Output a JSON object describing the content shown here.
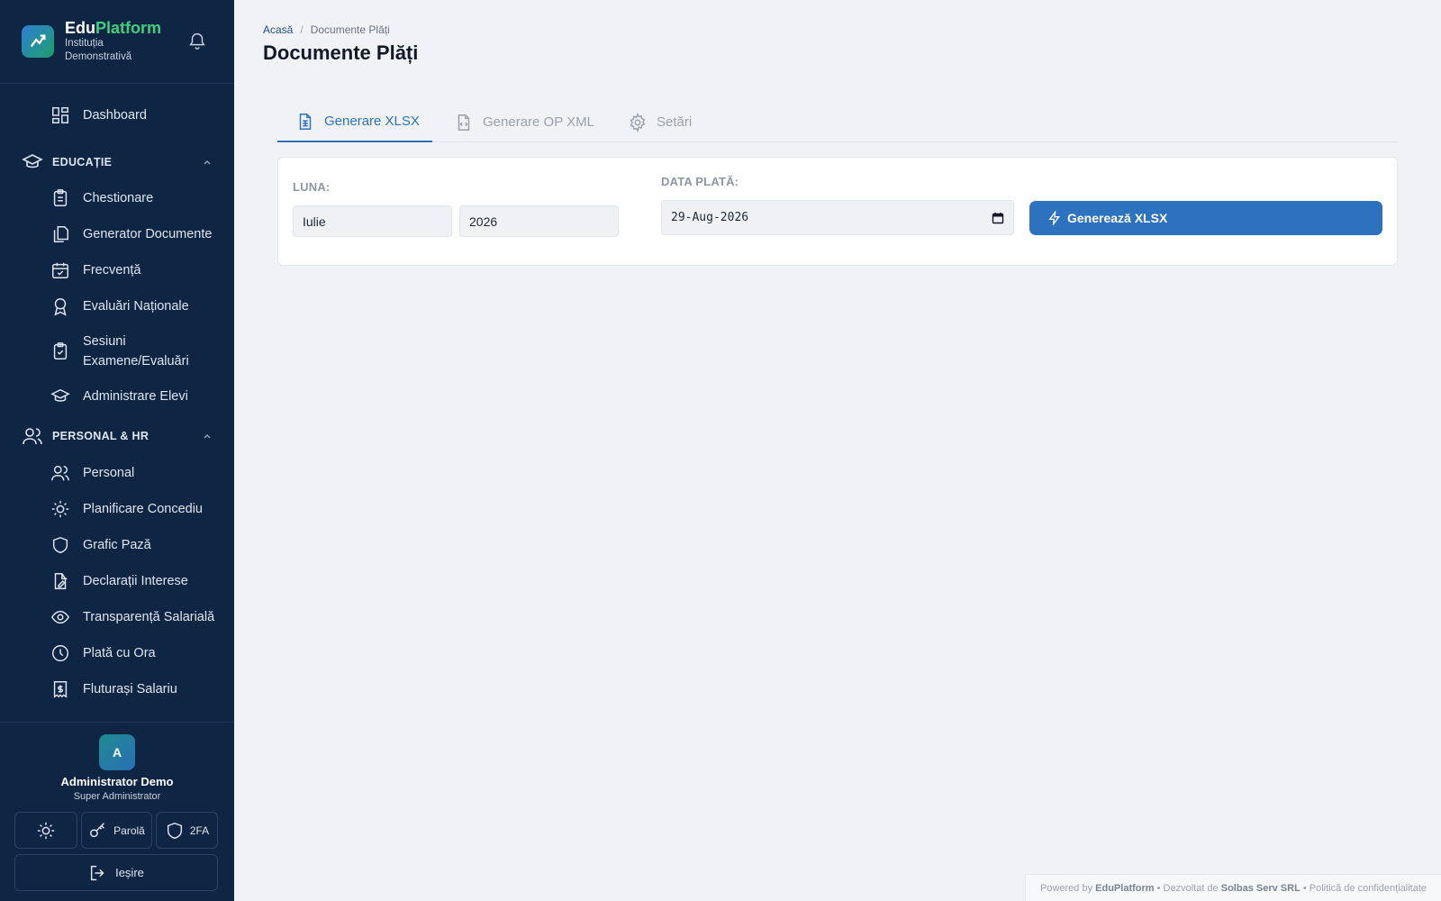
{
  "brand": {
    "name_part1": "Edu",
    "name_part2": "Platform",
    "institution": "Instituția Demonstrativă"
  },
  "sidebar": {
    "dashboard": "Dashboard",
    "sections": {
      "education": "EDUCAȚIE",
      "hr": "PERSONAL & HR"
    },
    "education_items": [
      "Chestionare",
      "Generator Documente",
      "Frecvență",
      "Evaluări Naționale",
      "Sesiuni Examene/Evaluări",
      "Administrare Elevi"
    ],
    "hr_items": [
      "Personal",
      "Planificare Concediu",
      "Grafic Pază",
      "Declarații Interese",
      "Transparență Salarială",
      "Plată cu Ora",
      "Fluturași Salariu"
    ]
  },
  "user": {
    "initial": "A",
    "name": "Administrator Demo",
    "role": "Super Administrator",
    "password_label": "Parolă",
    "twofa_label": "2FA",
    "logout_label": "Ieșire"
  },
  "breadcrumb": {
    "home": "Acasă",
    "separator": "/",
    "current": "Documente Plăți"
  },
  "page": {
    "title": "Documente Plăți"
  },
  "tabs": [
    {
      "label": "Generare XLSX",
      "active": true
    },
    {
      "label": "Generare OP XML",
      "active": false
    },
    {
      "label": "Setări",
      "active": false
    }
  ],
  "form": {
    "month_label": "LUNA:",
    "month_value": "Iulie",
    "year_value": "2026",
    "date_label": "DATA PLATĂ:",
    "date_value": "29-Aug-2026",
    "generate_label": "Generează XLSX"
  },
  "footer": {
    "powered": "Powered by",
    "product": "EduPlatform",
    "dev": "• Dezvoltat de",
    "company": "Solbas Serv SRL",
    "privacy": "• Politică de confidențialitate"
  },
  "colors": {
    "sidebar_bg": "#0f2544",
    "accent": "#2c72bf",
    "brand_green": "#3ecf7d"
  }
}
